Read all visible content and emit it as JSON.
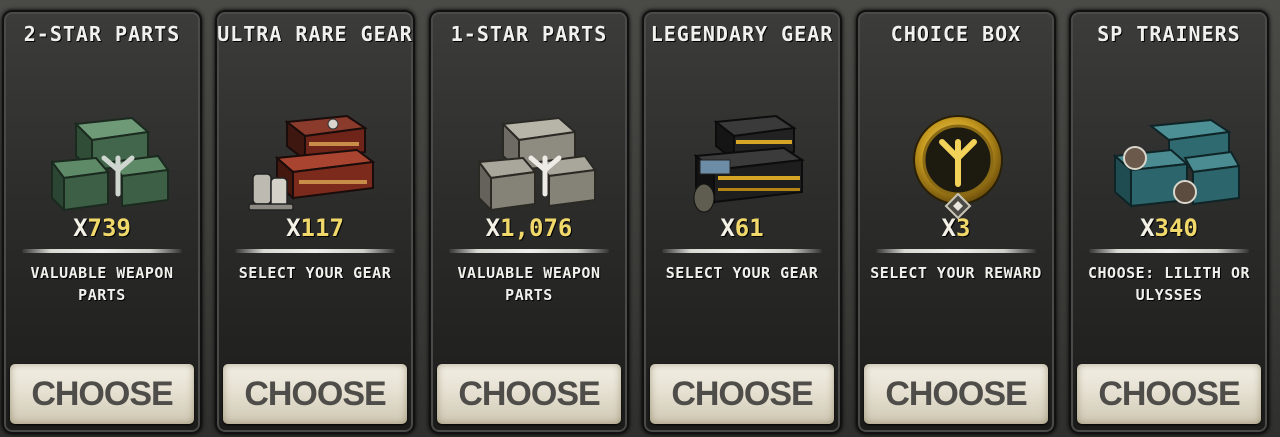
{
  "cards": [
    {
      "title": "2-STAR PARTS",
      "prefix": "X",
      "count": "739",
      "description": "VALUABLE WEAPON\nPARTS",
      "button": "CHOOSE",
      "icon": "green-crate-stack-icon"
    },
    {
      "title": "ULTRA RARE GEAR",
      "prefix": "X",
      "count": "117",
      "description": "SELECT YOUR GEAR",
      "button": "CHOOSE",
      "icon": "red-gear-case-icon"
    },
    {
      "title": "1-STAR PARTS",
      "prefix": "X",
      "count": "1,076",
      "description": "VALUABLE WEAPON\nPARTS",
      "button": "CHOOSE",
      "icon": "grey-crate-stack-icon"
    },
    {
      "title": "LEGENDARY GEAR",
      "prefix": "X",
      "count": "61",
      "description": "SELECT YOUR GEAR",
      "button": "CHOOSE",
      "icon": "gold-gear-case-icon"
    },
    {
      "title": "CHOICE BOX",
      "prefix": "X",
      "count": "3",
      "description": "SELECT YOUR REWARD",
      "button": "CHOOSE",
      "icon": "gold-choice-medallion-icon"
    },
    {
      "title": "SP TRAINERS",
      "prefix": "X",
      "count": "340",
      "description": "CHOOSE: LILITH OR\nULYSSES",
      "button": "CHOOSE",
      "icon": "teal-trainer-crates-icon"
    }
  ]
}
